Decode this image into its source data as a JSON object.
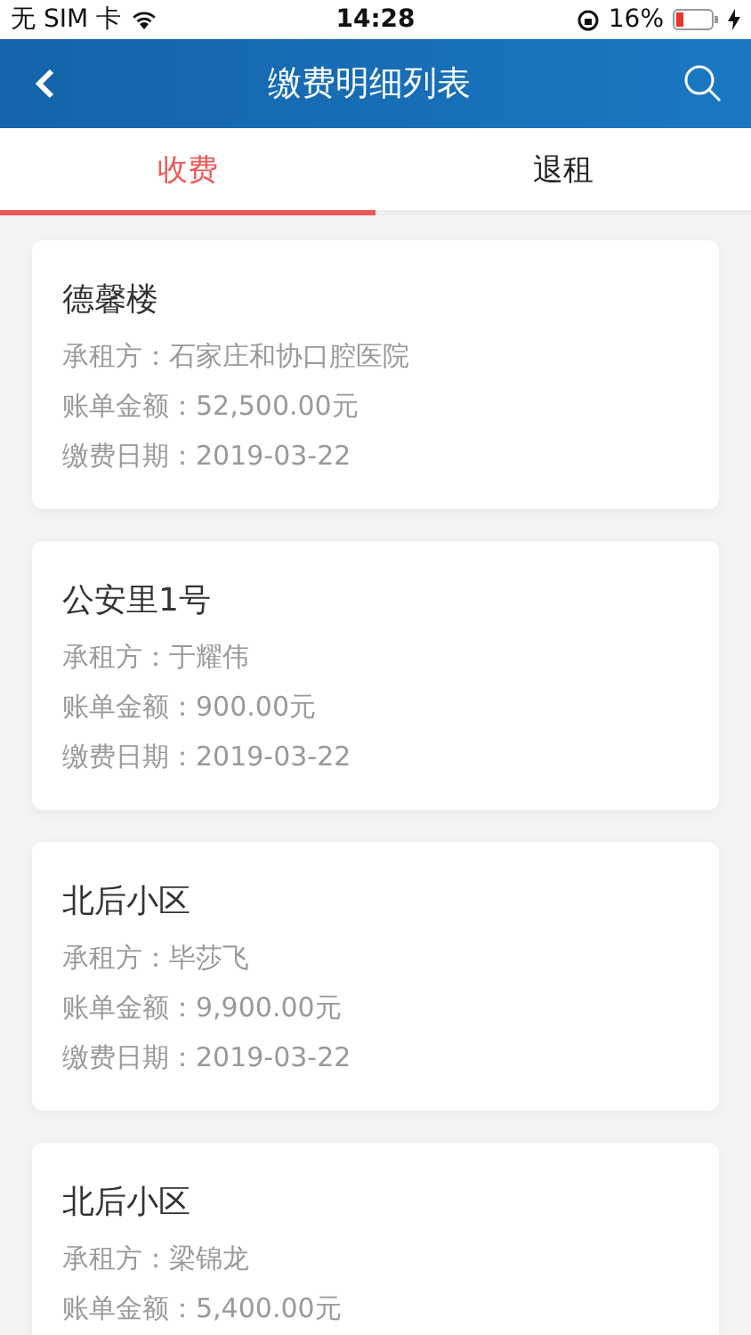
{
  "status_bar": {
    "carrier": "无 SIM 卡",
    "time": "14:28",
    "battery": "16%"
  },
  "nav_bar": {
    "title": "缴费明细列表"
  },
  "tabs": [
    {
      "label": "收费",
      "selected": true
    },
    {
      "label": "退租",
      "selected": false
    }
  ],
  "records": [
    {
      "title": "德馨楼",
      "lines": [
        "承租方：石家庄和协口腔医院",
        "账单金额：52,500.00元",
        "缴费日期：2019-03-22"
      ]
    },
    {
      "title": "公安里1号",
      "lines": [
        "承租方：于耀伟",
        "账单金额：900.00元",
        "缴费日期：2019-03-22"
      ]
    },
    {
      "title": "北后小区",
      "lines": [
        "承租方：毕莎飞",
        "账单金额：9,900.00元",
        "缴费日期：2019-03-22"
      ]
    },
    {
      "title": "北后小区",
      "lines": [
        "承租方：梁锦龙",
        "账单金额：5,400.00元"
      ]
    }
  ]
}
